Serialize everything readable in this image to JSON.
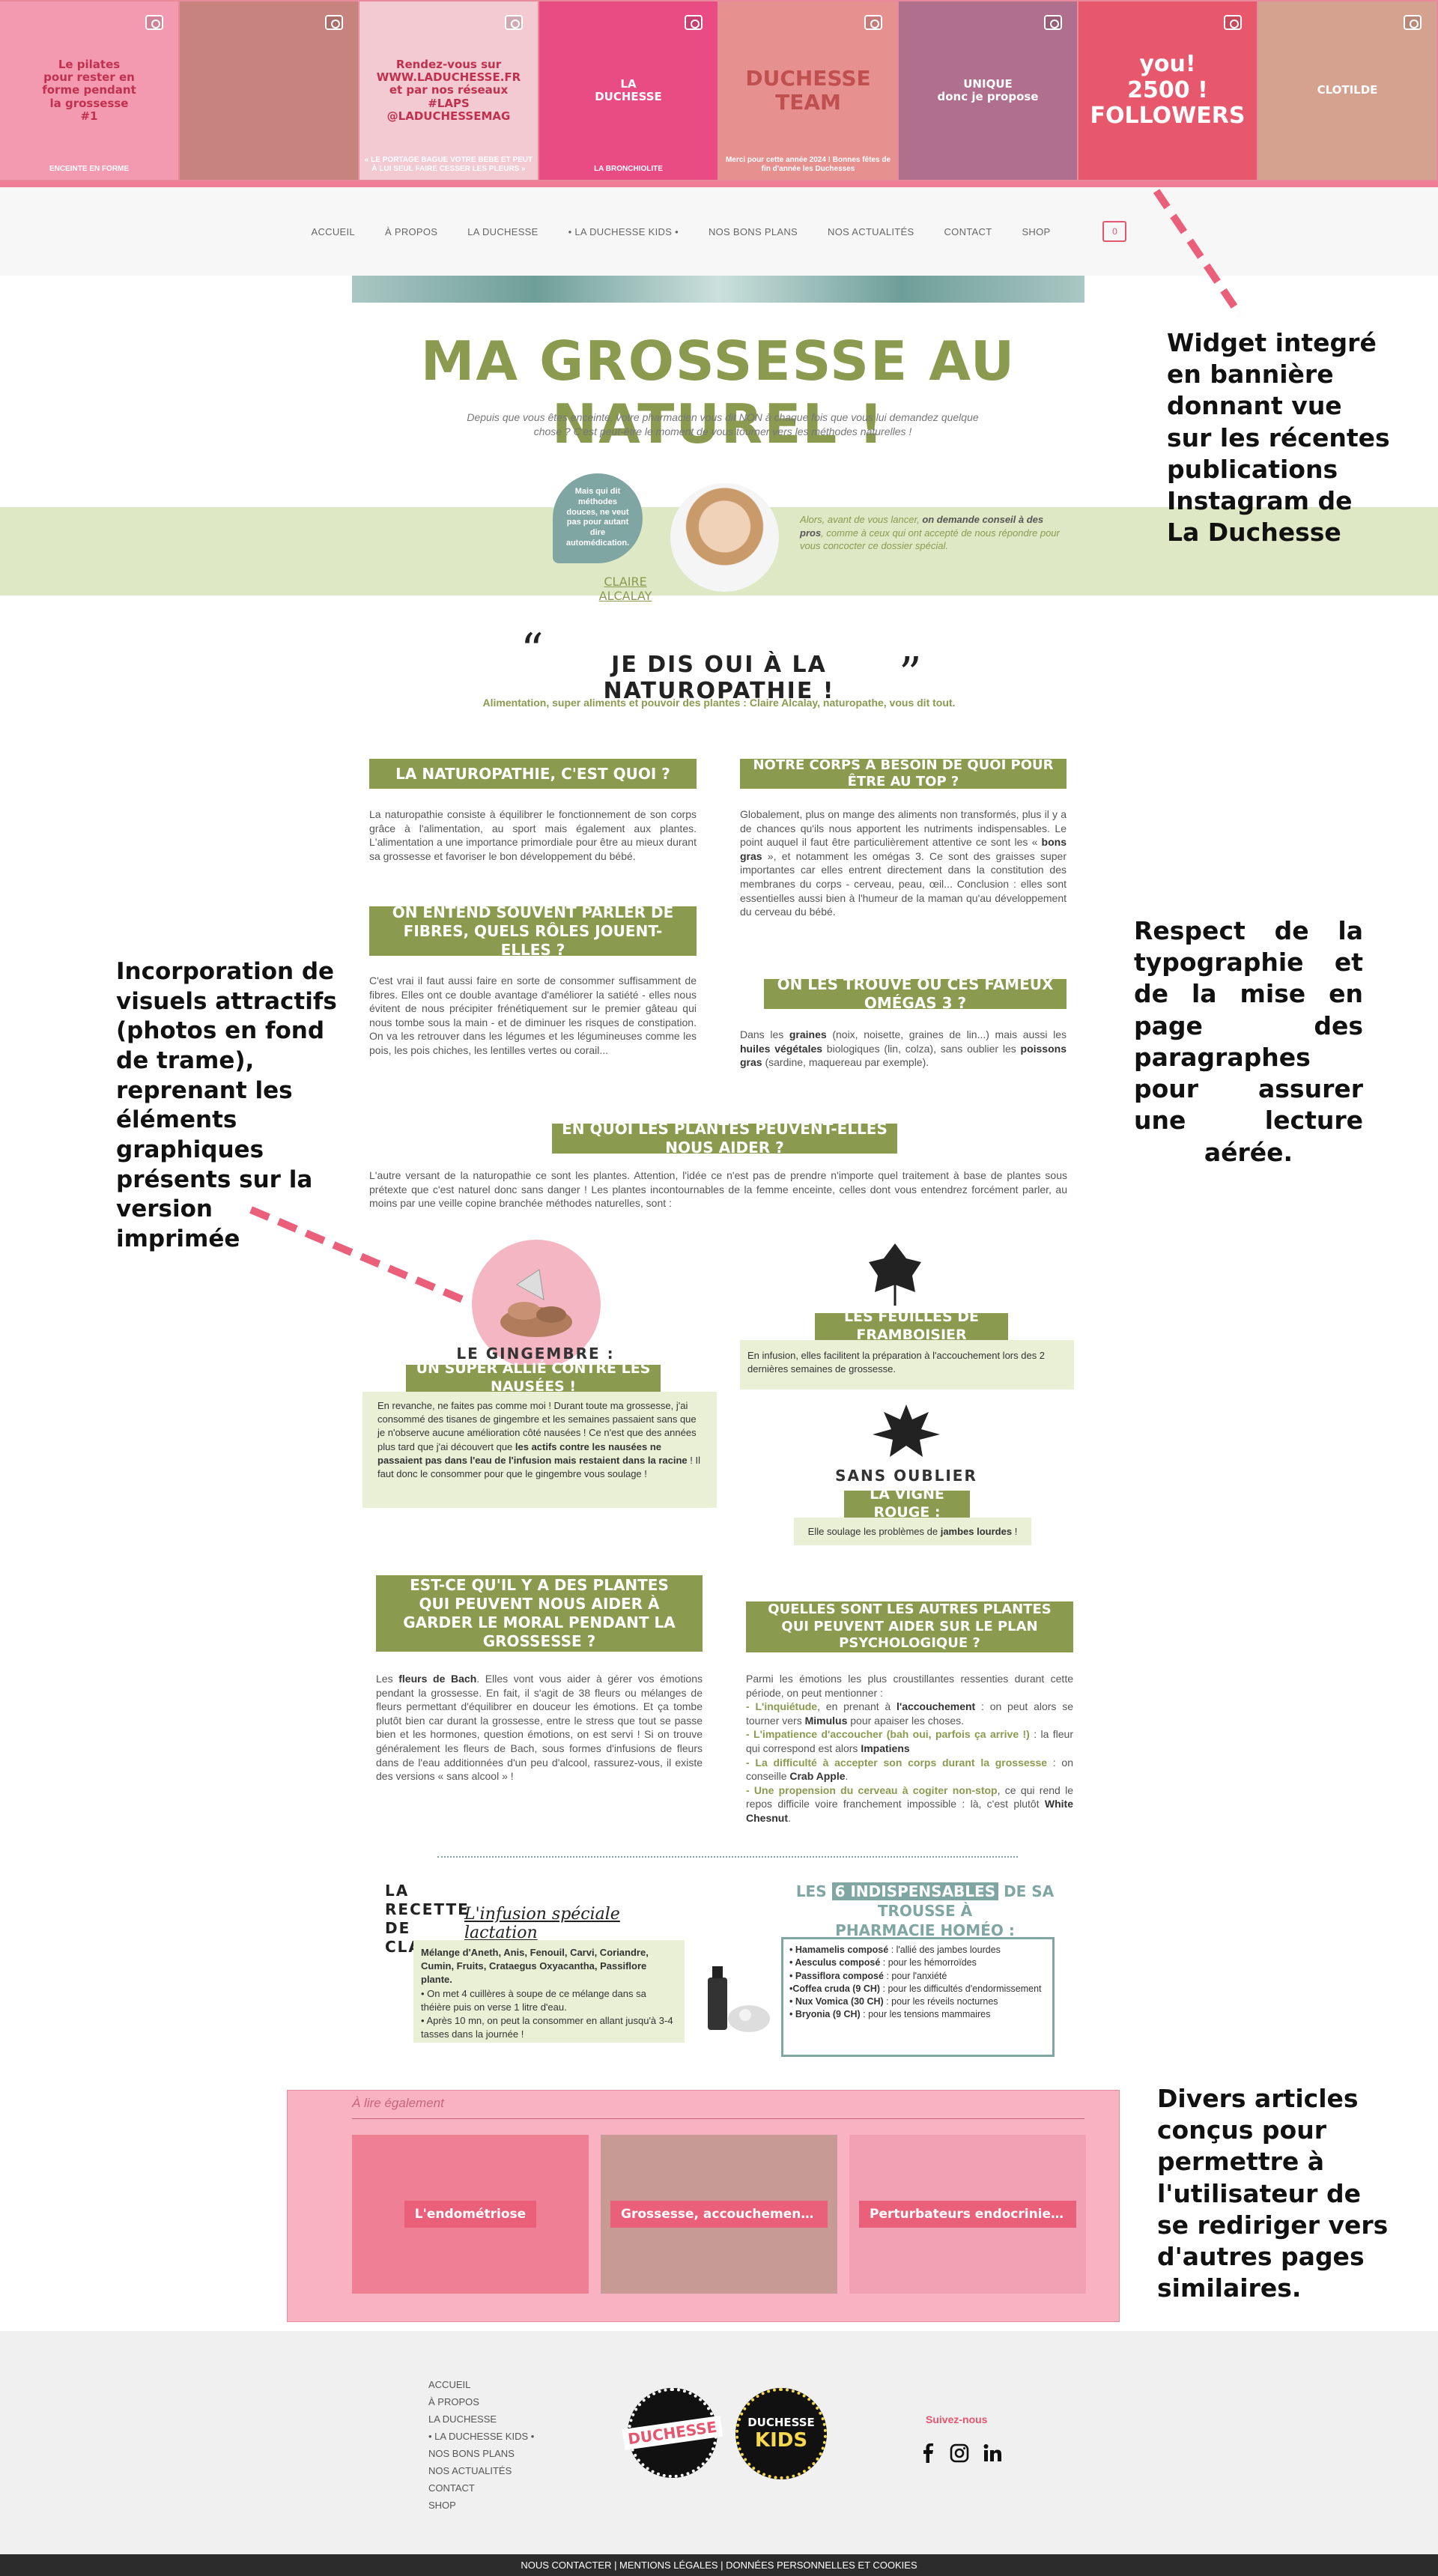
{
  "instagram": {
    "tiles": [
      {
        "lines": [
          "Le pilates",
          "pour rester en",
          "forme pendant",
          "la grossesse",
          "#1"
        ],
        "bottom": "ENCEINTE EN FORME",
        "bg": "#f39ab0",
        "tc": "#c0314f"
      },
      {
        "lines": [],
        "bottom": "",
        "bg": "#c7837e",
        "tc": "#fff"
      },
      {
        "lines": [
          "Rendez-vous sur",
          "WWW.LADUCHESSE.FR",
          "et par nos réseaux",
          "#LAPS",
          "@LADUCHESSEMAG"
        ],
        "bottom": "« LE PORTAGE BAGUE VOTRE BÉBÉ ET PEUT À LUI SEUL FAIRE CESSER LES PLEURS »",
        "bg": "#f3c9d2",
        "tc": "#c0314f"
      },
      {
        "lines": [
          "LA",
          "DUCHESSE"
        ],
        "bottom": "LA BRONCHIOLITE",
        "bg": "#e94c83",
        "tc": "#fff"
      },
      {
        "lines": [
          "DUCHESSE",
          "TEAM"
        ],
        "bottom": "Merci pour cette année 2024 ! Bonnes fêtes de fin d'année les Duchesses",
        "bg": "#e79090",
        "tc": "#c05050"
      },
      {
        "lines": [
          "UNIQUE",
          "donc je propose"
        ],
        "bottom": "",
        "bg": "#b06f8d",
        "tc": "#fff"
      },
      {
        "lines": [
          "you!",
          "2500 !",
          "FOLLOWERS"
        ],
        "bottom": "",
        "bg": "#e8586d",
        "tc": "#fff"
      },
      {
        "lines": [
          "CLOTILDE"
        ],
        "bottom": "",
        "bg": "#d5a28f",
        "tc": "#fff"
      }
    ]
  },
  "nav": {
    "items": [
      "ACCUEIL",
      "À PROPOS",
      "LA DUCHESSE",
      "• LA DUCHESSE KIDS •",
      "NOS BONS PLANS",
      "NOS ACTUALITÉS",
      "CONTACT",
      "SHOP"
    ],
    "cart_count": "0"
  },
  "article": {
    "title": "MA GROSSESSE AU NATUREL !",
    "intro": "Depuis que vous êtes enceinte, votre pharmacien vous dit NON à chaque fois que vous lui demandez quelque chose ? C'est peut-être le moment de vous tourner vers les méthodes naturelles !",
    "bubble": "Mais qui dit méthodes douces, ne veut pas pour autant dire automédication.",
    "author": "CLAIRE ALCALAY",
    "advice_pre": "Alors, avant de vous lancer, ",
    "advice_bold": "on demande conseil à des pros",
    "advice_post": ", comme à ceux qui ont accepté de nous répondre pour vous concocter ce dossier spécial.",
    "quote_title": "JE DIS OUI À LA NATUROPATHIE !",
    "quote_sub": "Alimentation, super aliments et pouvoir des plantes : Claire Alcalay, naturopathe, vous dit tout.",
    "h1": "LA NATUROPATHIE, C'EST QUOI ?",
    "p1": "La naturopathie consiste à équilibrer le fonctionnement de son corps grâce à l'alimentation, au sport mais également aux plantes. L'alimentation a une importance primordiale pour être au mieux durant sa grossesse et favoriser le bon développement du bébé.",
    "h2": "ON ENTEND SOUVENT PARLER DE FIBRES, QUELS RÔLES JOUENT-ELLES ?",
    "p2": "C'est vrai il faut aussi faire en sorte de consommer suffisamment de fibres. Elles ont ce double avantage d'améliorer la satiété - elles nous évitent de nous précipiter frénétiquement sur le premier gâteau qui nous tombe sous la main - et de diminuer les risques de constipation. On va les retrouver dans les légumes et les légumineuses comme les pois, les pois chiches, les lentilles vertes ou corail...",
    "h3": "NOTRE CORPS A BESOIN DE QUOI POUR ÊTRE AU TOP ?",
    "p3a": "Globalement, plus on mange des aliments non transformés, plus il y a de chances qu'ils nous apportent les nutriments indispensables. Le point auquel il faut être particulièrement attentive ce sont les « ",
    "p3b": "bons gras",
    "p3c": " », et notamment les omégas 3. Ce sont des graisses super importantes car elles entrent directement dans la constitution des membranes du corps - cerveau, peau, œil... Conclusion : elles sont essentielles aussi bien à l'humeur de la maman qu'au développement du cerveau du bébé.",
    "h4": "ON LES TROUVE OÙ CES FAMEUX OMÉGAS 3 ?",
    "p4a": "Dans les ",
    "p4b": "graines",
    "p4c": " (noix, noisette, graines de lin...) mais aussi les ",
    "p4d": "huiles végétales",
    "p4e": " biologiques (lin, colza), sans oublier les ",
    "p4f": "poissons gras",
    "p4g": " (sardine, maquereau par exemple).",
    "h5": "EN QUOI LES PLANTES PEUVENT-ELLES NOUS AIDER ?",
    "p5": "L'autre versant de la naturopathie ce sont les plantes. Attention, l'idée ce n'est pas de prendre n'importe quel traitement à base de plantes sous prétexte que c'est naturel donc sans danger ! Les plantes incontournables de la femme enceinte, celles dont vous entendrez forcément parler, au moins par une veille copine branchée méthodes naturelles, sont :",
    "ginger_t1": "LE GINGEMBRE :",
    "ginger_t2": "UN SUPER ALLIÉ CONTRE LES NAUSÉES !",
    "ginger_p": "En revanche, ne faites pas comme moi ! Durant toute ma grossesse, j'ai consommé des tisanes de gingembre et les semaines passaient sans que je n'observe aucune amélioration côté nausées ! Ce n'est que des années plus tard que j'ai découvert que ",
    "ginger_b": "les actifs contre les nausées ne passaient pas dans l'eau de l'infusion mais restaient dans la racine",
    "ginger_e": " ! Il faut donc le consommer pour que le gingembre vous soulage !",
    "rasp_t": "LES FEUILLES DE FRAMBOISIER",
    "rasp_p": "En infusion, elles facilitent la préparation à l'accouchement lors des 2 dernières semaines de grossesse.",
    "vine_t1": "SANS OUBLIER",
    "vine_t2": "LA VIGNE ROUGE :",
    "vine_p": "Elle soulage les problèmes de ",
    "vine_b": "jambes lourdes",
    "vine_e": " !",
    "h6": "EST-CE QU'IL Y A DES PLANTES QUI PEUVENT NOUS AIDER À GARDER LE MORAL PENDANT LA GROSSESSE ?",
    "p6a": "Les ",
    "p6b": "fleurs de Bach",
    "p6c": ". Elles vont vous aider à gérer vos émotions pendant la grossesse. En fait, il s'agit de 38 fleurs ou mélanges de fleurs permettant d'équilibrer en douceur les émotions. Et ça tombe plutôt bien car durant la grossesse, entre le stress que tout se passe bien et les hormones, question émotions, on est servi ! Si on trouve généralement les fleurs de Bach, sous formes d'infusions de fleurs dans de l'eau additionnées d'un peu d'alcool, rassurez-vous, il existe des versions « sans alcool » !",
    "h7": "QUELLES SONT LES AUTRES PLANTES QUI PEUVENT AIDER SUR LE PLAN PSYCHOLOGIQUE ?",
    "p7_intro": "Parmi les émotions les plus croustillantes ressenties durant cette période, on peut mentionner :",
    "p7_items": [
      {
        "g": "- L'inquiétude",
        "t": ", en prenant à ",
        "b": "l'accouchement",
        "t2": " : on peut alors se tourner vers ",
        "b2": "Mimulus",
        "t3": " pour apaiser les choses."
      },
      {
        "g": "- L'impatience d'accoucher (bah oui, parfois ça arrive !)",
        "t": " : la fleur qui correspond est alors ",
        "b": "Impatiens",
        "t2": "",
        "b2": "",
        "t3": ""
      },
      {
        "g": "- La difficulté à accepter son corps durant la grossesse",
        "t": " : on conseille ",
        "b": "Crab Apple",
        "t2": ".",
        "b2": "",
        "t3": ""
      },
      {
        "g": "- Une propension du cerveau à cogiter non-stop",
        "t": ", ce qui rend le repos difficile voire franchement impossible : là, c'est plutôt ",
        "b": "White Chesnut",
        "t2": ".",
        "b2": "",
        "t3": ""
      }
    ],
    "recipe_l1": "LA RECETTE",
    "recipe_l2": "DE CLAIRE",
    "recipe_title": "L'infusion spéciale lactation",
    "recipe_ing": "Mélange d'Aneth, Anis, Fenouil, Carvi, Coriandre, Cumin, Fruits, Crataegus Oxyacantha, Passiflore plante.",
    "recipe_s1": "• On met 4 cuillères à soupe de ce mélange dans sa théière puis on verse 1 litre d'eau.",
    "recipe_s2": "• Après 10 mn, on peut la consommer en allant jusqu'à 3-4 tasses dans la journée !",
    "kit_t1": "LES ",
    "kit_hl": "6 INDISPENSABLES",
    "kit_t2": " DE SA TROUSSE À",
    "kit_t3": "PHARMACIE HOMÉO :",
    "kit_items": [
      {
        "b": "• Hamamelis composé",
        "t": " : l'allié des jambes lourdes"
      },
      {
        "b": "• Aesculus composé",
        "t": " : pour les hémorroïdes"
      },
      {
        "b": "• Passiflora composé",
        "t": " : pour l'anxiété"
      },
      {
        "b": "•Coffea cruda (9 CH)",
        "t": " : pour les difficultés d'endormissement"
      },
      {
        "b": "• Nux Vomica (30 CH)",
        "t": " : pour les réveils nocturnes"
      },
      {
        "b": "• Bryonia (9 CH)",
        "t": " : pour les tensions mammaires"
      }
    ]
  },
  "related": {
    "heading": "À lire également",
    "cards": [
      {
        "label": "L'endométriose",
        "bg": "#ef7f94"
      },
      {
        "label": "Grossesse, accouchement...",
        "bg": "#c79a95"
      },
      {
        "label": "Perturbateurs endocriniens",
        "bg": "#f2a1b2"
      }
    ]
  },
  "annotations": {
    "a1": "Widget integré en bannière donnant vue sur les récentes publications Instagram de La Duchesse",
    "a2": "Respect de la typographie et de la mise en page des paragraphes pour assurer une lecture aérée.",
    "a3": "Incorporation de visuels attractifs (photos en fond de trame), reprenant les éléments graphiques présents sur la version imprimée",
    "a4": "Divers articles conçus pour permettre à l'utilisateur de se rediriger vers d'autres pages similaires."
  },
  "footer": {
    "links": [
      "ACCUEIL",
      "À PROPOS",
      "LA DUCHESSE",
      "• LA DUCHESSE KIDS •",
      "NOS BONS PLANS",
      "NOS ACTUALITÉS",
      "CONTACT",
      "SHOP"
    ],
    "logo1": "DUCHESSE",
    "logo2a": "DUCHESSE",
    "logo2b": "KIDS",
    "follow": "Suivez-nous",
    "bottom": "NOUS CONTACTER | MENTIONS LÉGALES | DONNÉES PERSONNELLES ET COOKIES"
  },
  "colors": {
    "accent_green": "#8a9a4f",
    "pink": "#ea607a",
    "light_green": "#eaf0d6"
  }
}
